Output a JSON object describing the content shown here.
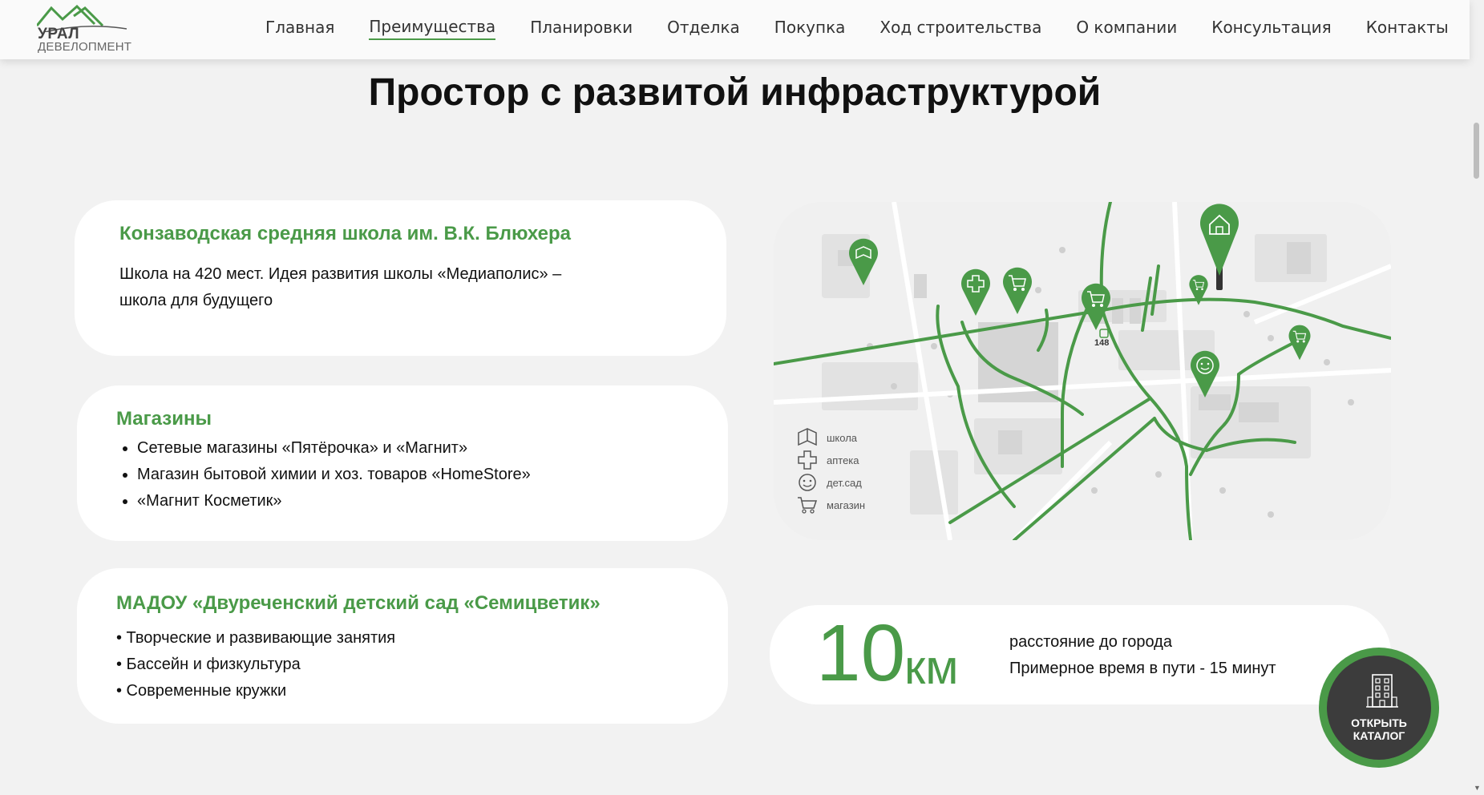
{
  "header": {
    "logo": {
      "line1": "УРАЛ",
      "line2": "ДЕВЕЛОПМЕНТ"
    },
    "nav": [
      {
        "label": "Главная",
        "active": false
      },
      {
        "label": "Преимущества",
        "active": true
      },
      {
        "label": "Планировки",
        "active": false
      },
      {
        "label": "Отделка",
        "active": false
      },
      {
        "label": "Покупка",
        "active": false
      },
      {
        "label": "Ход строительства",
        "active": false
      },
      {
        "label": "О компании",
        "active": false
      },
      {
        "label": "Консультация",
        "active": false
      },
      {
        "label": "Контакты",
        "active": false
      }
    ]
  },
  "section": {
    "title": "Простор с развитой инфраструктурой"
  },
  "cards": {
    "school": {
      "heading": "Конзаводская средняя школа им. В.К. Блюхера",
      "line1": "Школа на 420 мест. Идея развития школы «Медиаполис» –",
      "line2": "школа для будущего"
    },
    "shops": {
      "heading": "Магазины",
      "items": [
        "Сетевые магазины «Пятёрочка» и «Магнит»",
        "Магазин бытовой химии и хоз. товаров «HomeStore»",
        "«Магнит Косметик»"
      ]
    },
    "kindergarten": {
      "heading": "МАДОУ «Двуреченский детский сад «Семицветик»",
      "items": [
        "• Творческие и развивающие занятия",
        "• Бассейн и физкультура",
        "• Современные кружки"
      ]
    }
  },
  "map": {
    "legend": [
      "школа",
      "аптека",
      "дет.сад",
      "магазин"
    ],
    "bus_number": "148"
  },
  "distance": {
    "value": "10",
    "unit": "км",
    "line1": "расстояние до города",
    "line2": "Примерное время в пути - 15 минут"
  },
  "catalog_button": {
    "line1": "ОТКРЫТЬ",
    "line2": "КАТАЛОГ"
  },
  "colors": {
    "accent": "#4a9a48",
    "background": "#f2f2f2",
    "card": "#ffffff",
    "button_dark": "#3c3c3c"
  }
}
